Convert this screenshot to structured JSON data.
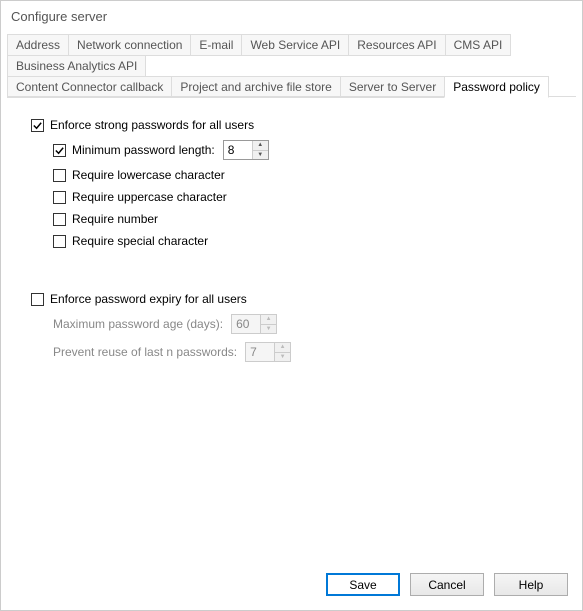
{
  "window": {
    "title": "Configure server"
  },
  "tabs": {
    "row1": [
      "Address",
      "Network connection",
      "E-mail",
      "Web Service API",
      "Resources API",
      "CMS API",
      "Business Analytics API"
    ],
    "row2": [
      "Content Connector callback",
      "Project and archive file store",
      "Server to Server",
      "Password policy"
    ],
    "active": "Password policy"
  },
  "strong": {
    "enforce": {
      "label": "Enforce strong passwords for all users",
      "checked": true
    },
    "minlen": {
      "label": "Minimum password length:",
      "checked": true,
      "value": "8"
    },
    "lower": {
      "label": "Require lowercase character",
      "checked": false
    },
    "upper": {
      "label": "Require uppercase character",
      "checked": false
    },
    "number": {
      "label": "Require number",
      "checked": false
    },
    "special": {
      "label": "Require special character",
      "checked": false
    }
  },
  "expiry": {
    "enforce": {
      "label": "Enforce password expiry for all users",
      "checked": false
    },
    "maxage": {
      "label": "Maximum password age (days):",
      "value": "60"
    },
    "reuse": {
      "label": "Prevent reuse of last n passwords:",
      "value": "7"
    }
  },
  "buttons": {
    "save": "Save",
    "cancel": "Cancel",
    "help": "Help"
  }
}
